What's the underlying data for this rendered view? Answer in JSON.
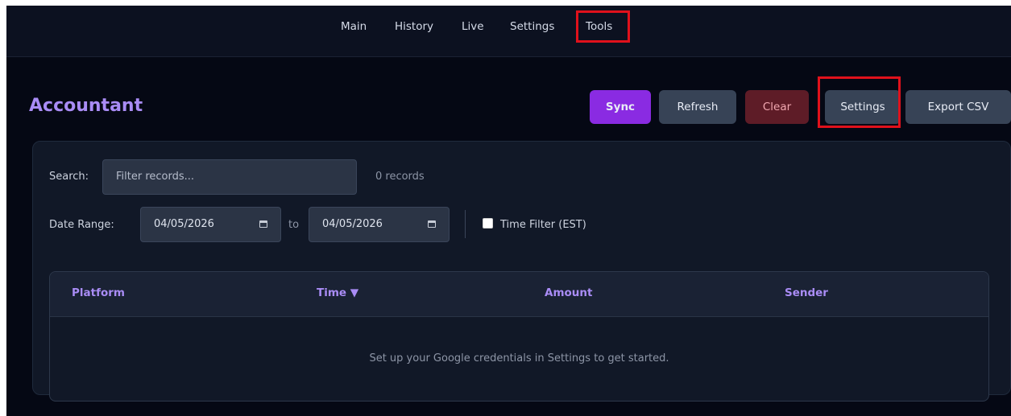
{
  "nav": {
    "items": [
      "Main",
      "History",
      "Live",
      "Settings",
      "Tools"
    ]
  },
  "header": {
    "title": "Accountant"
  },
  "toolbar": {
    "sync_label": "Sync",
    "refresh_label": "Refresh",
    "clear_label": "Clear",
    "settings_label": "Settings",
    "export_label": "Export CSV"
  },
  "filters": {
    "search_label": "Search:",
    "search_placeholder": "Filter records...",
    "records_count": "0 records",
    "date_range_label": "Date Range:",
    "date_from": "04/05/2026",
    "to_label": "to",
    "date_to": "04/05/2026",
    "time_filter_label": "Time Filter (EST)"
  },
  "table": {
    "columns": [
      "Platform",
      "Time ▼",
      "Amount",
      "Sender"
    ],
    "empty_message": "Set up your Google credentials in Settings to get started."
  },
  "colors": {
    "accent": "#8a2be2",
    "title": "#a98cf5",
    "highlight": "#e0111b"
  },
  "icons": {
    "date_picker": "calendar-icon"
  }
}
